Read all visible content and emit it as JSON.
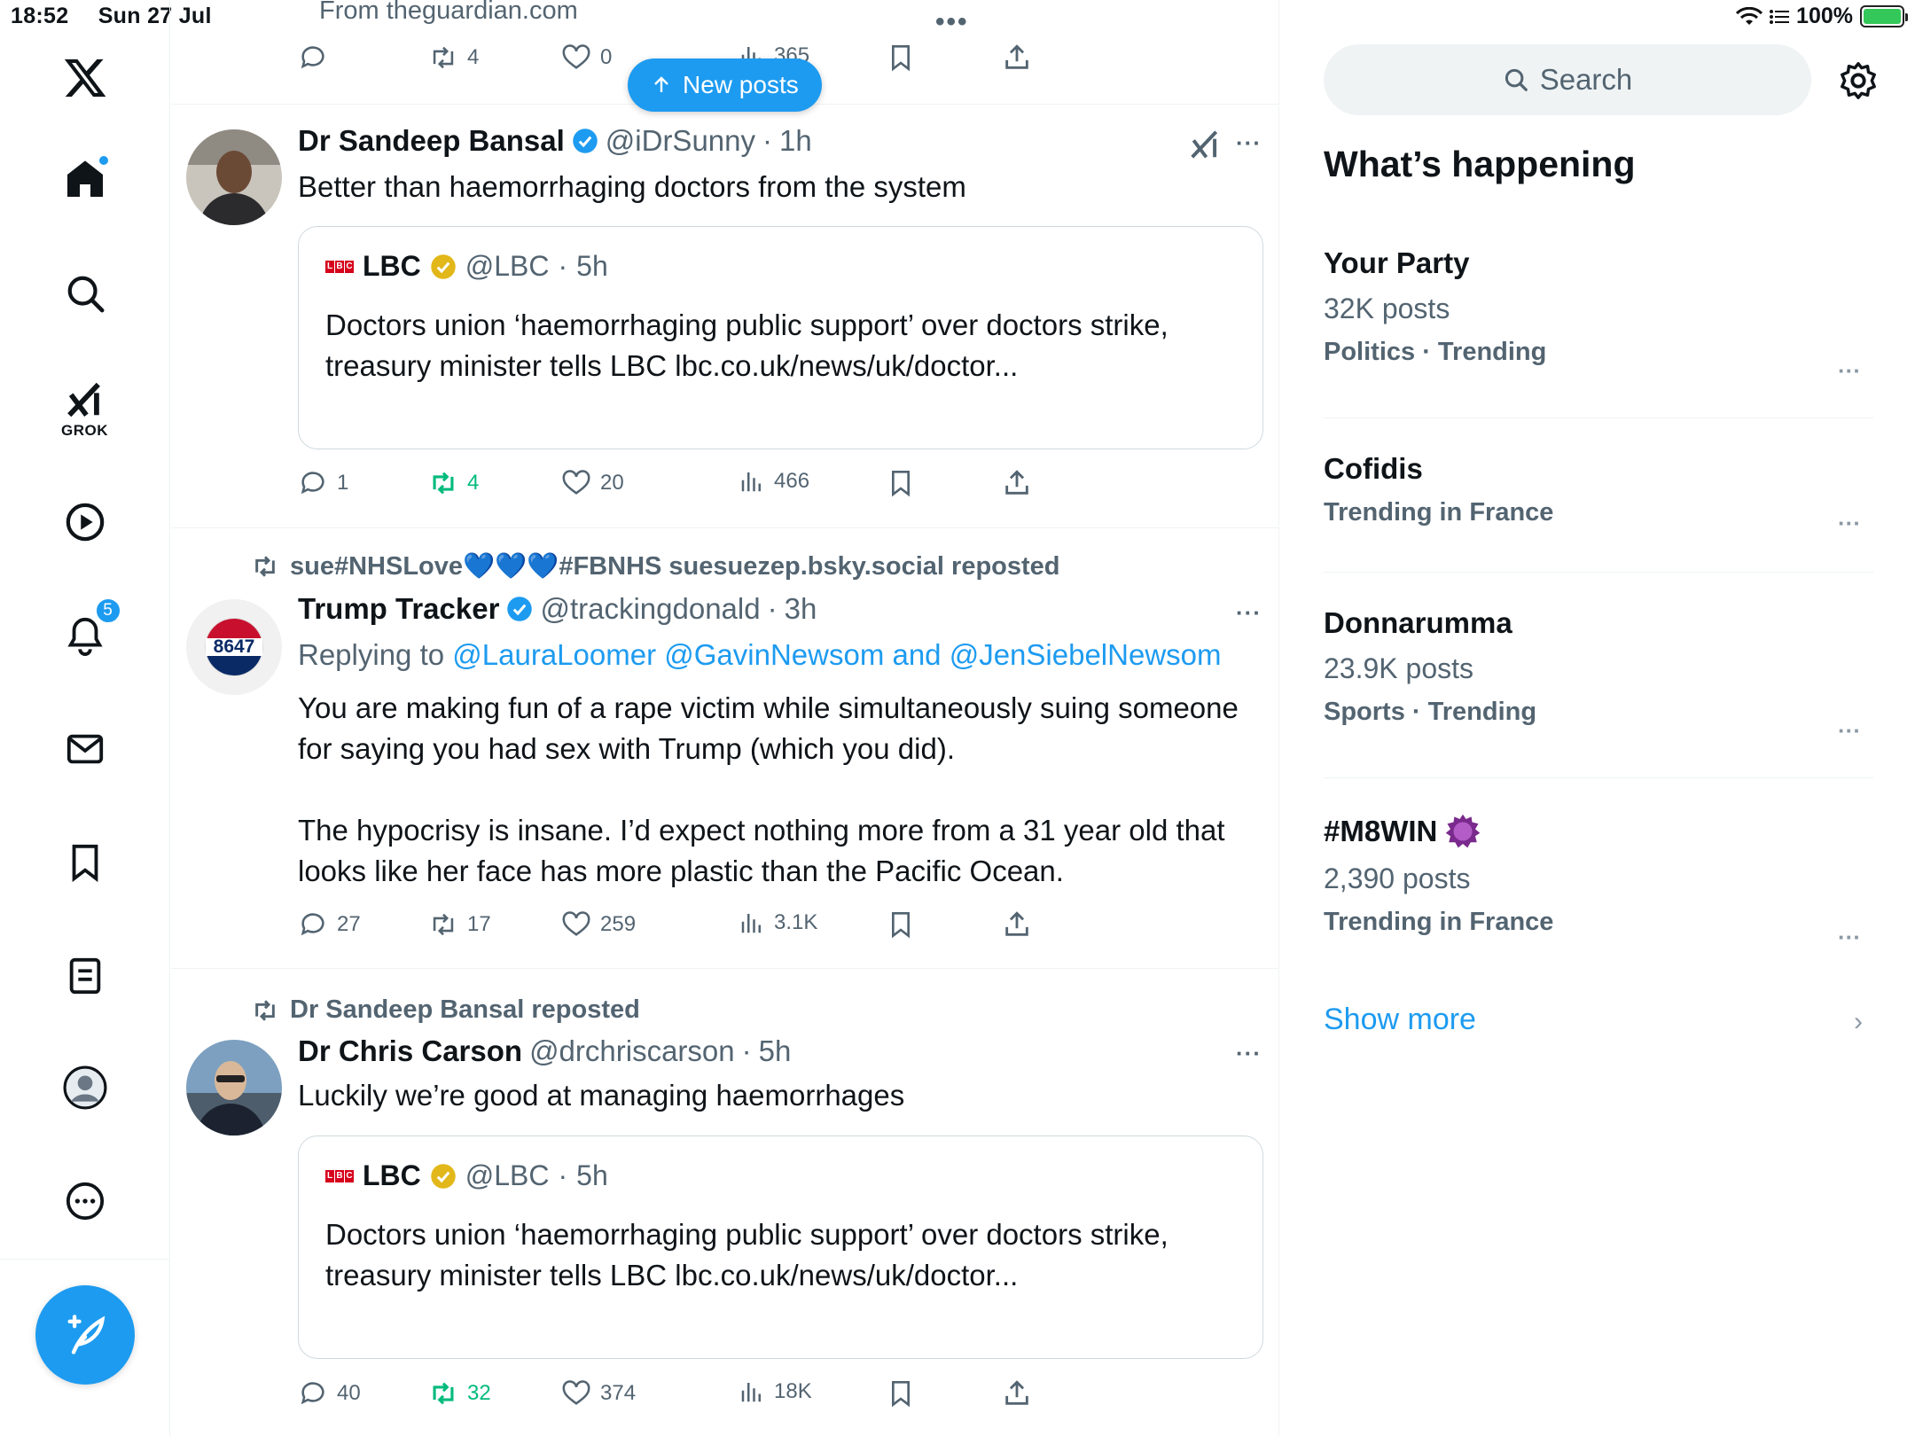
{
  "status": {
    "time": "18:52",
    "date": "Sun 27 Jul",
    "battery": "100%"
  },
  "nav": {
    "grok_label": "GROK",
    "notifications_count": "5"
  },
  "feed": {
    "from_line": "From theguardian.com",
    "top_actions": {
      "reposts": "4",
      "likes": "0",
      "views": "365"
    },
    "new_posts_label": "New posts",
    "tweets": [
      {
        "name": "Dr Sandeep Bansal",
        "handle": "@iDrSunny",
        "time": "1h",
        "text": "Better than haemorrhaging doctors from the system",
        "quote": {
          "name": "LBC",
          "handle": "@LBC",
          "time": "5h",
          "text": "Doctors union ‘haemorrhaging public support’ over doctors strike, treasury minister tells LBC lbc.co.uk/news/uk/doctor..."
        },
        "replies": "1",
        "reposts": "4",
        "likes": "20",
        "views": "466"
      },
      {
        "reposted_by": "sue#NHSLove💙💙💙#FBNHS suesuezep.bsky.social reposted",
        "name": "Trump Tracker",
        "handle": "@trackingdonald",
        "time": "3h",
        "replying_prefix": "Replying to",
        "replying_mentions": "@LauraLoomer @GavinNewsom and @JenSiebelNewsom",
        "text": "You are making fun of a rape victim while simultaneously suing someone for saying you had sex with Trump (which you did).\n\nThe hypocrisy is insane. I’d expect nothing more from a 31 year old that looks like her face has more plastic than the Pacific Ocean.",
        "avatar_text": "8647",
        "replies": "27",
        "reposts": "17",
        "likes": "259",
        "views": "3.1K"
      },
      {
        "reposted_by": "Dr Sandeep Bansal reposted",
        "name": "Dr Chris Carson",
        "handle": "@drchriscarson",
        "time": "5h",
        "text": "Luckily we’re good at managing haemorrhages",
        "quote": {
          "name": "LBC",
          "handle": "@LBC",
          "time": "5h",
          "text": "Doctors union ‘haemorrhaging public support’ over doctors strike, treasury minister tells LBC lbc.co.uk/news/uk/doctor..."
        },
        "replies": "40",
        "reposts": "32",
        "likes": "374",
        "views": "18K"
      }
    ]
  },
  "sidebar": {
    "search_placeholder": "Search",
    "title": "What’s happening",
    "trends": [
      {
        "name": "Your Party",
        "posts": "32K posts",
        "category": "Politics · Trending"
      },
      {
        "name": "Cofidis",
        "category": "Trending in France"
      },
      {
        "name": "Donnarumma",
        "posts": "23.9K posts",
        "category": "Sports · Trending"
      },
      {
        "name": "#M8WIN",
        "posts": "2,390 posts",
        "category": "Trending in France"
      }
    ],
    "show_more": "Show more"
  },
  "colors": {
    "accent": "#1d9bf0",
    "repost_green": "#00ba7c",
    "muted": "#536471"
  }
}
